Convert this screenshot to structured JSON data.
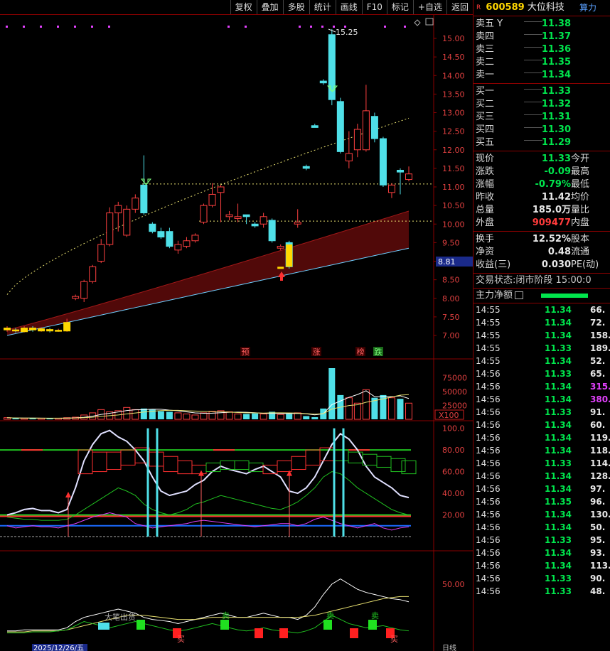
{
  "toolbar": [
    "复权",
    "叠加",
    "多股",
    "统计",
    "画线",
    "F10",
    "标记",
    "+自选",
    "返回"
  ],
  "stock": {
    "badge": "R",
    "code": "600589",
    "name": "大位科技",
    "tag": "算力"
  },
  "asks": [
    {
      "label": "卖五",
      "price": "11.38",
      "flag": "Y"
    },
    {
      "label": "卖四",
      "price": "11.37"
    },
    {
      "label": "卖三",
      "price": "11.36"
    },
    {
      "label": "卖二",
      "price": "11.35"
    },
    {
      "label": "卖一",
      "price": "11.34"
    }
  ],
  "bids": [
    {
      "label": "买一",
      "price": "11.33"
    },
    {
      "label": "买二",
      "price": "11.32"
    },
    {
      "label": "买三",
      "price": "11.31"
    },
    {
      "label": "买四",
      "price": "11.30"
    },
    {
      "label": "买五",
      "price": "11.29"
    }
  ],
  "quote": [
    {
      "label": "现价",
      "value": "11.33",
      "color": "green",
      "extra": "今开"
    },
    {
      "label": "涨跌",
      "value": "-0.09",
      "color": "green",
      "extra": "最高"
    },
    {
      "label": "涨幅",
      "value": "-0.79%",
      "color": "green",
      "extra": "最低"
    },
    {
      "label": "昨收",
      "value": "11.42",
      "color": "white",
      "extra": "均价"
    },
    {
      "label": "总量",
      "value": "185.0万",
      "color": "white",
      "extra": "量比"
    },
    {
      "label": "外盘",
      "value": "909477",
      "color": "red",
      "extra": "内盘"
    }
  ],
  "fin": [
    {
      "label": "换手",
      "value": "12.52%",
      "extra": "股本"
    },
    {
      "label": "净资",
      "value": "0.48",
      "extra": "流通"
    },
    {
      "label": "收益(三)",
      "value": "0.030",
      "extra": "PE(动)"
    }
  ],
  "status": {
    "label": "交易状态:",
    "phase": "闭市阶段",
    "time": "15:00:0"
  },
  "flow_label": "主力净额",
  "ticks": [
    {
      "t": "14:55",
      "p": "11.34",
      "v": "66.",
      "c": "white"
    },
    {
      "t": "14:55",
      "p": "11.34",
      "v": "72.",
      "c": "white"
    },
    {
      "t": "14:55",
      "p": "11.34",
      "v": "158.",
      "c": "white"
    },
    {
      "t": "14:55",
      "p": "11.33",
      "v": "189.",
      "c": "white"
    },
    {
      "t": "14:55",
      "p": "11.34",
      "v": "52.",
      "c": "white"
    },
    {
      "t": "14:56",
      "p": "11.33",
      "v": "65.",
      "c": "white"
    },
    {
      "t": "14:56",
      "p": "11.34",
      "v": "315.",
      "c": "purple"
    },
    {
      "t": "14:56",
      "p": "11.34",
      "v": "380.",
      "c": "purple"
    },
    {
      "t": "14:56",
      "p": "11.33",
      "v": "91.",
      "c": "white"
    },
    {
      "t": "14:56",
      "p": "11.34",
      "v": "60.",
      "c": "white"
    },
    {
      "t": "14:56",
      "p": "11.34",
      "v": "119.",
      "c": "white"
    },
    {
      "t": "14:56",
      "p": "11.34",
      "v": "118.",
      "c": "white"
    },
    {
      "t": "14:56",
      "p": "11.33",
      "v": "114.",
      "c": "white"
    },
    {
      "t": "14:56",
      "p": "11.34",
      "v": "128.",
      "c": "white"
    },
    {
      "t": "14:56",
      "p": "11.34",
      "v": "97.",
      "c": "white"
    },
    {
      "t": "14:56",
      "p": "11.35",
      "v": "96.",
      "c": "white"
    },
    {
      "t": "14:56",
      "p": "11.34",
      "v": "130.",
      "c": "white"
    },
    {
      "t": "14:56",
      "p": "11.34",
      "v": "50.",
      "c": "white"
    },
    {
      "t": "14:56",
      "p": "11.33",
      "v": "95.",
      "c": "white"
    },
    {
      "t": "14:56",
      "p": "11.34",
      "v": "93.",
      "c": "white"
    },
    {
      "t": "14:56",
      "p": "11.34",
      "v": "113.",
      "c": "white"
    },
    {
      "t": "14:56",
      "p": "11.33",
      "v": "90.",
      "c": "white"
    },
    {
      "t": "14:56",
      "p": "11.33",
      "v": "48.",
      "c": "white"
    }
  ],
  "chart": {
    "price_axis": [
      "15.00",
      "14.50",
      "14.00",
      "13.50",
      "13.00",
      "12.50",
      "12.00",
      "11.50",
      "11.00",
      "10.50",
      "10.00",
      "9.50",
      "9.00",
      "8.50",
      "8.00",
      "7.50",
      "7.00"
    ],
    "high_label": "15.25",
    "cursor_price": "8.81",
    "events": [
      "预",
      "涨",
      "榜",
      "跌"
    ],
    "vol_axis": [
      "75000",
      "50000",
      "25000"
    ],
    "vol_unit": "X100",
    "osc_axis": [
      "100.0",
      "80.00",
      "60.00",
      "40.00",
      "20.00"
    ],
    "bottom_axis": [
      "50.00"
    ],
    "bottom_texts": [
      "大笔出货",
      "卖",
      "卖",
      "卖",
      "买",
      "买"
    ],
    "date_label": "2025/12/26/五",
    "week_label": "日线",
    "candles": [
      {
        "o": 7.15,
        "c": 7.2,
        "h": 7.25,
        "l": 7.1,
        "up": true
      },
      {
        "o": 7.15,
        "c": 7.12,
        "h": 7.2,
        "l": 7.08,
        "up": false
      },
      {
        "o": 7.1,
        "c": 7.2,
        "h": 7.25,
        "l": 7.08,
        "up": true
      },
      {
        "o": 7.2,
        "c": 7.15,
        "h": 7.25,
        "l": 7.1,
        "up": false
      },
      {
        "o": 7.12,
        "c": 7.18,
        "h": 7.22,
        "l": 7.1,
        "up": true
      },
      {
        "o": 7.16,
        "c": 7.12,
        "h": 7.2,
        "l": 7.08,
        "up": false
      },
      {
        "o": 7.12,
        "c": 7.14,
        "h": 7.18,
        "l": 7.1,
        "up": true
      },
      {
        "o": 7.12,
        "c": 7.35,
        "h": 7.45,
        "l": 7.1,
        "up": true
      },
      {
        "o": 8.0,
        "c": 8.05,
        "h": 8.1,
        "l": 7.95,
        "up": true
      },
      {
        "o": 8.0,
        "c": 8.45,
        "h": 8.5,
        "l": 7.9,
        "up": true
      },
      {
        "o": 8.45,
        "c": 8.85,
        "h": 8.9,
        "l": 8.4,
        "up": true
      },
      {
        "o": 9.0,
        "c": 9.45,
        "h": 9.6,
        "l": 8.95,
        "up": true
      },
      {
        "o": 9.45,
        "c": 10.3,
        "h": 10.45,
        "l": 9.4,
        "up": true
      },
      {
        "o": 10.5,
        "c": 10.3,
        "h": 10.6,
        "l": 9.8,
        "up": true
      },
      {
        "o": 9.7,
        "c": 10.4,
        "h": 10.5,
        "l": 9.65,
        "up": true
      },
      {
        "o": 10.4,
        "c": 10.7,
        "h": 10.8,
        "l": 10.3,
        "up": true
      },
      {
        "o": 10.3,
        "c": 11.05,
        "h": 11.85,
        "l": 10.25,
        "up": false
      },
      {
        "o": 10.0,
        "c": 9.8,
        "h": 10.05,
        "l": 9.75,
        "up": false
      },
      {
        "o": 9.8,
        "c": 9.65,
        "h": 9.9,
        "l": 9.6,
        "up": false
      },
      {
        "o": 9.8,
        "c": 9.4,
        "h": 9.9,
        "l": 9.35,
        "up": false
      },
      {
        "o": 9.3,
        "c": 9.45,
        "h": 9.55,
        "l": 9.2,
        "up": true
      },
      {
        "o": 9.4,
        "c": 9.55,
        "h": 9.65,
        "l": 9.35,
        "up": true
      },
      {
        "o": 9.55,
        "c": 9.7,
        "h": 9.75,
        "l": 9.5,
        "up": true
      },
      {
        "o": 10.05,
        "c": 10.5,
        "h": 10.55,
        "l": 10.0,
        "up": true
      },
      {
        "o": 10.5,
        "c": 10.8,
        "h": 11.1,
        "l": 10.45,
        "up": true
      },
      {
        "o": 11.0,
        "c": 10.85,
        "h": 11.05,
        "l": 10.05,
        "up": true
      },
      {
        "o": 10.2,
        "c": 10.25,
        "h": 10.35,
        "l": 10.1,
        "up": true
      },
      {
        "o": 10.15,
        "c": 10.2,
        "h": 10.55,
        "l": 10.05,
        "up": true
      },
      {
        "o": 10.25,
        "c": 10.2,
        "h": 10.25,
        "l": 10.0,
        "up": false
      },
      {
        "o": 10.0,
        "c": 9.95,
        "h": 10.05,
        "l": 9.9,
        "up": false
      },
      {
        "o": 10.0,
        "c": 10.2,
        "h": 10.3,
        "l": 9.9,
        "up": true
      },
      {
        "o": 10.1,
        "c": 9.55,
        "h": 10.15,
        "l": 9.5,
        "up": false
      },
      {
        "o": 9.35,
        "c": 9.4,
        "h": 9.45,
        "l": 9.3,
        "up": true
      },
      {
        "o": 9.5,
        "c": 8.85,
        "h": 9.55,
        "l": 8.8,
        "up": false
      },
      {
        "o": 10.0,
        "c": 10.05,
        "h": 10.4,
        "l": 9.9,
        "up": true
      },
      {
        "o": 11.5,
        "c": 11.55,
        "h": 11.6,
        "l": 11.45,
        "up": false
      },
      {
        "o": 12.6,
        "c": 12.65,
        "h": 12.7,
        "l": 12.6,
        "up": false
      },
      {
        "o": 13.8,
        "c": 13.85,
        "h": 13.9,
        "l": 13.75,
        "up": false
      },
      {
        "o": 15.1,
        "c": 13.35,
        "h": 15.25,
        "l": 13.2,
        "up": false
      },
      {
        "o": 13.3,
        "c": 11.95,
        "h": 13.4,
        "l": 11.9,
        "up": false
      },
      {
        "o": 11.7,
        "c": 11.9,
        "h": 12.5,
        "l": 11.5,
        "up": true
      },
      {
        "o": 12.0,
        "c": 12.55,
        "h": 12.7,
        "l": 11.8,
        "up": true
      },
      {
        "o": 12.0,
        "c": 13.05,
        "h": 13.75,
        "l": 11.95,
        "up": true
      },
      {
        "o": 12.9,
        "c": 12.3,
        "h": 13.0,
        "l": 12.2,
        "up": false
      },
      {
        "o": 12.3,
        "c": 11.05,
        "h": 12.35,
        "l": 11.0,
        "up": false
      },
      {
        "o": 10.85,
        "c": 11.05,
        "h": 11.1,
        "l": 10.7,
        "up": true
      },
      {
        "o": 11.4,
        "c": 11.45,
        "h": 11.5,
        "l": 10.8,
        "up": false
      },
      {
        "o": 11.2,
        "c": 11.35,
        "h": 11.55,
        "l": 11.15,
        "up": true
      }
    ],
    "volumes": [
      3,
      2,
      2,
      2,
      2,
      2,
      2,
      3,
      4,
      8,
      12,
      18,
      14,
      16,
      22,
      18,
      20,
      18,
      15,
      14,
      12,
      10,
      8,
      12,
      15,
      16,
      14,
      10,
      10,
      11,
      10,
      14,
      9,
      10,
      12,
      6,
      4,
      20,
      95,
      45,
      40,
      30,
      55,
      40,
      45,
      40,
      38,
      30
    ]
  }
}
